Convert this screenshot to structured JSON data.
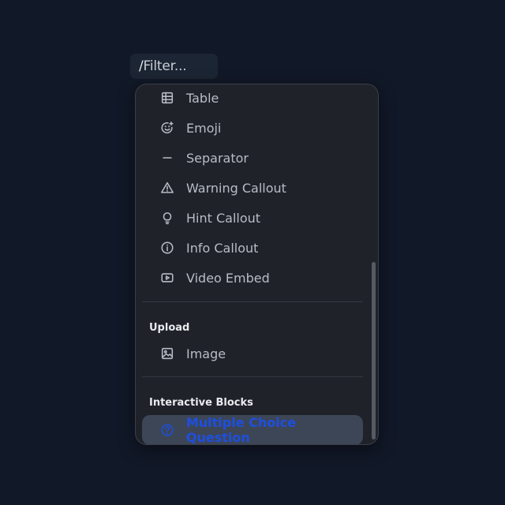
{
  "filter": {
    "slash": "/",
    "placeholder": "Filter..."
  },
  "menu": {
    "items": [
      {
        "label": "Table",
        "icon": "table-icon"
      },
      {
        "label": "Emoji",
        "icon": "emoji-icon"
      },
      {
        "label": "Separator",
        "icon": "separator-icon"
      },
      {
        "label": "Warning Callout",
        "icon": "warning-icon"
      },
      {
        "label": "Hint Callout",
        "icon": "lightbulb-icon"
      },
      {
        "label": "Info Callout",
        "icon": "info-icon"
      },
      {
        "label": "Video Embed",
        "icon": "video-icon"
      }
    ],
    "upload": {
      "title": "Upload",
      "items": [
        {
          "label": "Image",
          "icon": "image-icon"
        }
      ]
    },
    "interactive": {
      "title": "Interactive Blocks",
      "items": [
        {
          "label": "Multiple Choice Question",
          "icon": "question-circle-icon",
          "selected": true
        }
      ]
    }
  },
  "colors": {
    "background": "#111827",
    "menu_background": "#1f2229",
    "selected_item_background": "#3d4657",
    "accent": "#1d4fe0",
    "text": "#b7bcc6"
  }
}
